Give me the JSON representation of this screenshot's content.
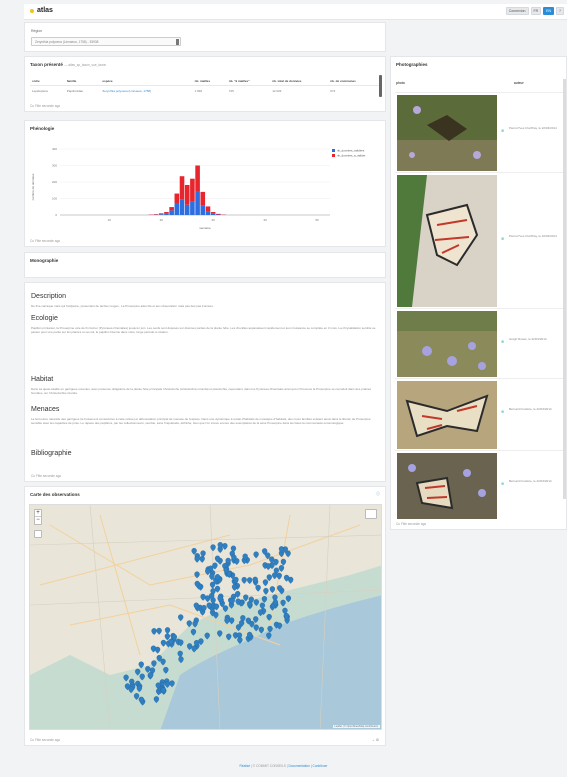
{
  "app": {
    "name": "atlas"
  },
  "header": {
    "buttons": [
      "Connexion",
      "FR",
      "EN",
      "?"
    ]
  },
  "region": {
    "label": "Région",
    "selected": "Zerynthia polyxena (Linnaeus, 1758) - 53938"
  },
  "taxon": {
    "title": "Taxon présenté",
    "subtitle": "atlas_sp_taxon_vue_taxon",
    "columns": [
      "ordre",
      "famille",
      "espèce",
      "nb. mailles",
      "nb. \"à mailles\"",
      "nb. total de données",
      "nb. de communes"
    ],
    "row": [
      "Lepidoptera",
      "Papilionidae",
      "Zerynthia polyxena (Linnaeus, 1758)",
      "1 892",
      "745",
      "12 004",
      "674"
    ],
    "footer": "Cu Filte seconde ago"
  },
  "phenology": {
    "title": "Phénologie",
    "ylabel": "nombre de données",
    "xlabel": "semaine",
    "footer": "Cu Filte seconde ago"
  },
  "chart_data": {
    "type": "bar",
    "categories": [
      "1",
      "2",
      "3",
      "4",
      "5",
      "6",
      "7",
      "8",
      "9",
      "10",
      "11",
      "12",
      "13",
      "14",
      "15",
      "16",
      "17",
      "18",
      "19",
      "20",
      "21",
      "22",
      "23",
      "24",
      "25",
      "26",
      "27",
      "28",
      "29",
      "30",
      "31",
      "32",
      "33",
      "34",
      "35",
      "36",
      "37",
      "38",
      "39",
      "40",
      "41",
      "42",
      "43",
      "44",
      "45",
      "46",
      "47",
      "48",
      "49",
      "50",
      "51",
      "52"
    ],
    "series": [
      {
        "name": "nb_données_a_valider",
        "color": "#e8242d",
        "values": [
          0,
          0,
          0,
          0,
          0,
          0,
          0,
          0,
          0,
          0,
          0,
          0,
          0,
          0,
          0,
          0,
          0,
          2,
          3,
          5,
          8,
          20,
          60,
          140,
          120,
          140,
          160,
          80,
          30,
          10,
          4,
          2,
          0,
          0,
          0,
          0,
          0,
          0,
          0,
          0,
          0,
          0,
          0,
          0,
          0,
          0,
          0,
          0,
          0,
          0,
          0,
          0
        ]
      },
      {
        "name": "nb_données_validées",
        "color": "#2d6fe0",
        "values": [
          0,
          0,
          0,
          0,
          0,
          0,
          0,
          0,
          0,
          0,
          0,
          0,
          0,
          0,
          0,
          0,
          0,
          1,
          2,
          5,
          10,
          28,
          70,
          95,
          62,
          80,
          140,
          60,
          22,
          8,
          3,
          1,
          0,
          0,
          0,
          0,
          0,
          0,
          0,
          0,
          0,
          0,
          0,
          0,
          0,
          0,
          0,
          0,
          0,
          0,
          0,
          0
        ]
      }
    ],
    "stacked": true,
    "yticks": [
      "0",
      "100",
      "200",
      "300",
      "400"
    ],
    "xticks": [
      "10",
      "20",
      "30",
      "40",
      "50"
    ],
    "ylim": [
      0,
      400
    ],
    "legend": "top-right"
  },
  "monographie": {
    "title": "Monographie"
  },
  "description": {
    "sections": [
      {
        "heading": "Description",
        "text": "De fine carraque mais qui l'art/jaune, presentant de taches rouges ; La Proserpine ailes blé et aux observation mais pas des pas Fumées."
      },
      {
        "heading": "Ecologie",
        "text": "Papillon printanier, la Proserpine vole de fin février (Pyrénées-Orientales) jusqu'en juin. Les oeufs sont déposés sur diverses parties de la plante hôte. Les chenilles apparaissent rapidement et leur croissance se complète en 3 mois. La chrysalidation semble se passer pour une partie sur les plantes ou au sol, le papillon hiverne dans votre ronge période à rotation."
      },
      {
        "heading": "Habitat",
        "text": "Dans sa quasi-totalité en garrigues ouvertes, avec présence obligatoire de la plante hôte principale l'Aristoloche (Aristolochia rotunda) et pistolochia, cependant, dans les Pyrénées-Orientales ainsi qu'en Provence la Proserpine se reproduit dans des prairies humides, sur l'Aristolochia rotunda."
      },
      {
        "heading": "Menaces",
        "text": "La fermeture naturelle des garrigues (le boisement consécutive à cette relève) et déforestation principal de menace de l'espèce. Dans une dynamique à retrait d'habitats de mosaïque d'habitats, des cours familles existent aussi dans le littoral, de Proserpine sensible avec les capacités de prise. Le rapace des papillons, par les collectionneurs, semble, sans l'inquiétude, défriche, bien que l'on trouve encore des exemplaires de la série Proserpine dans les listes la communauté entomologique."
      },
      {
        "heading": "Bibliographie",
        "text": ""
      }
    ],
    "footer": "Cu Filte seconde ago"
  },
  "map": {
    "title": "Carte des observations",
    "attribution": "Leaflet | © OpenStreetMap contributors",
    "footer": "Cu Filte seconde ago"
  },
  "photos": {
    "title": "Photographies",
    "columns": [
      "photo",
      "auteur"
    ],
    "items": [
      {
        "author": "Pierre/Yves Cloriffray, le 22/04/2014"
      },
      {
        "author": "Pierre/Yves Cloriffray, le 22/04/2014"
      },
      {
        "author": "Grégh Rosés, le 22/04/2014"
      },
      {
        "author": "Bernard Fondère, le 22/04/2014"
      },
      {
        "author": "Bernard Fondère, le 22/04/2014"
      }
    ],
    "footer": "Cu Filte seconde ago"
  },
  "footer": {
    "text": "Réalisé",
    "mid": "| © COMMIT CONSEILS |",
    "doc": "Documentation",
    "contact": "| Contribuer"
  }
}
